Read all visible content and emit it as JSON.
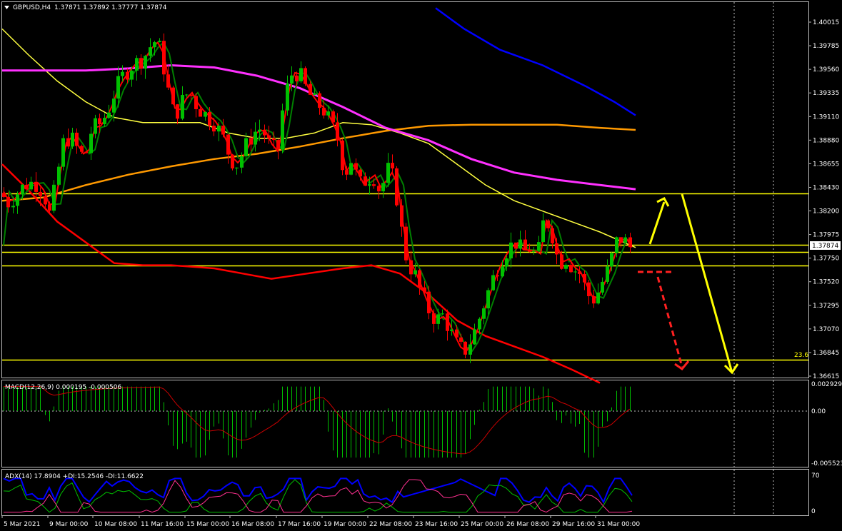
{
  "header": {
    "symbol": "GBPUSD,H4",
    "ohlc": "1.37871 1.37892 1.37777 1.37874"
  },
  "price_panel": {
    "current_price_label": "1.37874",
    "fib_label": "23.6",
    "y_ticks": [
      "1.40015",
      "1.39785",
      "1.39560",
      "1.39335",
      "1.39110",
      "1.38880",
      "1.38655",
      "1.38430",
      "1.38200",
      "1.37975",
      "1.37750",
      "1.37520",
      "1.37295",
      "1.37070",
      "1.36845",
      "1.36615"
    ]
  },
  "macd_panel": {
    "label": "MACD(12,26,9) 0.000195 -0.000506",
    "y_ticks": [
      "0.002929",
      "0.00",
      "-0.005523"
    ]
  },
  "adx_panel": {
    "label": "ADX(14) 17.8904 +DI:15.2546 -DI:11.6622",
    "y_ticks": [
      "70",
      "0"
    ]
  },
  "x_axis": {
    "ticks": [
      "5 Mar 2021",
      "9 Mar 00:00",
      "10 Mar 08:00",
      "11 Mar 16:00",
      "15 Mar 00:00",
      "16 Mar 08:00",
      "17 Mar 16:00",
      "19 Mar 00:00",
      "22 Mar 08:00",
      "23 Mar 16:00",
      "25 Mar 00:00",
      "26 Mar 08:00",
      "29 Mar 16:00",
      "31 Mar 00:00"
    ]
  },
  "colors": {
    "bull": "#00c000",
    "bear": "#ff0000",
    "ma_fast": "#ff0000",
    "ma_signal": "#008000",
    "ma_yellow": "#ffff40",
    "ma_orange": "#ff9900",
    "ma_magenta": "#ff30ff",
    "ma_blue": "#0000ff",
    "ma_red_slow": "#ff0000",
    "level": "#ffff00",
    "macd_hist": "#00c000",
    "macd_signal": "#ff0000",
    "adx": "#0000ff",
    "plus_di": "#00c000",
    "minus_di": "#ff3090"
  },
  "chart_data": [
    {
      "type": "candlestick",
      "symbol": "GBPUSD",
      "timeframe": "H4",
      "ylim": [
        1.36615,
        1.40115
      ],
      "horizontal_levels": [
        1.38372,
        1.37874,
        1.3781,
        1.3768,
        1.3677
      ],
      "x_range": [
        "5 Mar 2021",
        "31 Mar 2021"
      ],
      "series_overview": "GBPUSD H4 price: rise from ~1.383 to ~1.400 (11 Mar), range 1.387-1.396, drop to ~1.368 (25 Mar), recovery to ~1.3787"
    },
    {
      "type": "bar",
      "title": "MACD(12,26,9) 0.000195 -0.000506",
      "ylim": [
        -0.005523,
        0.002929
      ]
    },
    {
      "type": "line",
      "title": "ADX(14) 17.8904 +DI:15.2546 -DI:11.6622",
      "ylim": [
        0,
        70
      ]
    }
  ]
}
